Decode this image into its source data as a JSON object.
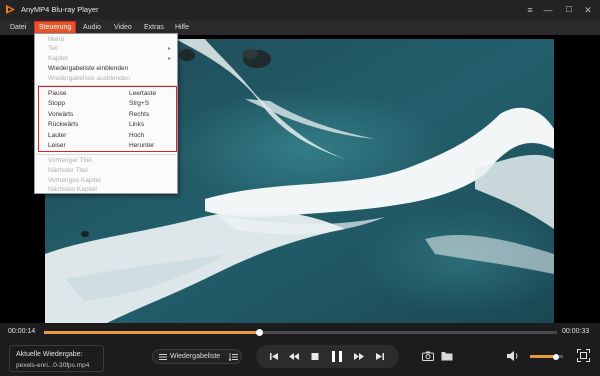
{
  "window": {
    "title": "AnyMP4 Blu-ray Player"
  },
  "menubar": {
    "items": [
      {
        "label": "Datei"
      },
      {
        "label": "Steuerung"
      },
      {
        "label": "Audio"
      },
      {
        "label": "Video"
      },
      {
        "label": "Extras"
      },
      {
        "label": "Hilfe"
      }
    ],
    "active": "Steuerung"
  },
  "dropdown": {
    "items": [
      {
        "label": "Menü",
        "disabled": true
      },
      {
        "label": "Teil",
        "disabled": true,
        "submenu": true
      },
      {
        "label": "Kapitel",
        "disabled": true,
        "submenu": true
      },
      {
        "label": "Wiedergabeliste einblenden",
        "disabled": false
      },
      {
        "label": "Wiedergabeliste ausblenden",
        "disabled": true
      },
      {
        "label": "Pause",
        "shortcut": "Leertaste",
        "disabled": false
      },
      {
        "label": "Stopp",
        "shortcut": "Strg+S",
        "disabled": false
      },
      {
        "label": "Vorwärts",
        "shortcut": "Rechts",
        "disabled": false
      },
      {
        "label": "Rückwärts",
        "shortcut": "Links",
        "disabled": false
      },
      {
        "label": "Lauter",
        "shortcut": "Hoch",
        "disabled": false
      },
      {
        "label": "Leiser",
        "shortcut": "Herunter",
        "disabled": false
      },
      {
        "label": "Vorheriger Titel",
        "disabled": true
      },
      {
        "label": "Nächster Titel",
        "disabled": true
      },
      {
        "label": "Vorheriges Kapitel",
        "disabled": true
      },
      {
        "label": "Nächstes Kapitel",
        "disabled": true
      }
    ]
  },
  "player": {
    "elapsed": "00:00:14",
    "total": "00:00:33",
    "progress": 0.42,
    "volume": 0.8,
    "now_playing_label": "Aktuelle Wiedergabe:",
    "now_playing_file": "pexels-enri...0-30fps.mp4",
    "playlist_label": "Wiedergabeliste"
  },
  "colors": {
    "accent": "#e89a3a",
    "menu_active": "#e8552a",
    "highlight_border": "#e0202a"
  },
  "icons": [
    "app-logo-icon",
    "minimize-icon",
    "maximize-icon",
    "close-icon",
    "playlist-icon",
    "playlist-sort-icon",
    "previous-track-icon",
    "rewind-icon",
    "stop-icon",
    "pause-icon",
    "forward-icon",
    "next-track-icon",
    "snapshot-icon",
    "folder-icon",
    "volume-icon",
    "fullscreen-icon"
  ]
}
